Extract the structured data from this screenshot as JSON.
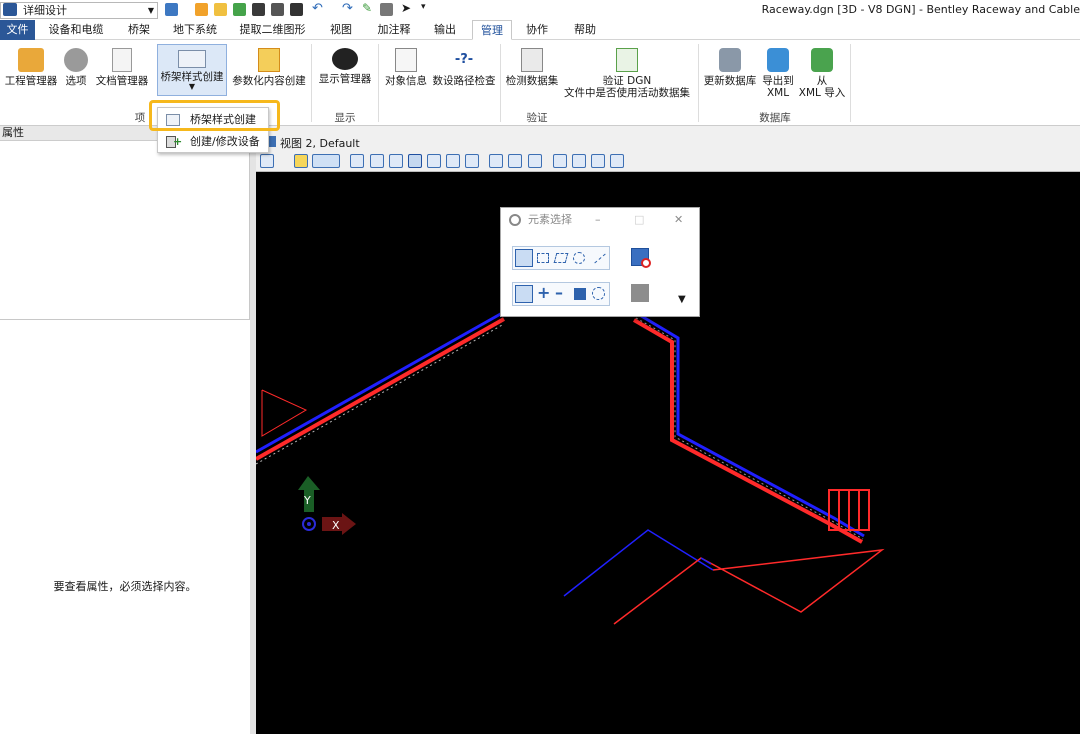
{
  "quick_access": {
    "workspace_value": "详细设计"
  },
  "window": {
    "title": "Raceway.dgn [3D - V8 DGN] - Bentley Raceway and Cable"
  },
  "tabs": [
    "文件",
    "设备和电缆",
    "桥架",
    "地下系统",
    "提取二维图形",
    "视图",
    "加注释",
    "输出",
    "管理",
    "协作",
    "帮助"
  ],
  "active_tab": "管理",
  "ribbon": {
    "project_group": {
      "label": "项目",
      "buttons": [
        "工程管理器",
        "选项",
        "文档管理器",
        "桥架样式创建",
        "参数化内容创建"
      ]
    },
    "display_group": {
      "label": "显示",
      "buttons": [
        "显示管理器"
      ]
    },
    "verify_group": {
      "label": "验证",
      "buttons": [
        "对象信息",
        "数设路径检查",
        "检测数据集"
      ],
      "verify_dgn_line1": "验证 DGN",
      "verify_dgn_line2": "文件中是否使用活动数据集"
    },
    "database_group": {
      "label": "数据库",
      "update_db": "更新数据库",
      "export_line1": "导出到",
      "export_line2": "XML",
      "import_line1": "从",
      "import_line2": "XML 导入"
    }
  },
  "dropdown_menu": {
    "items": [
      "桥架样式创建",
      "创建/修改设备"
    ]
  },
  "properties_panel": {
    "title": "属性",
    "empty_message": "要查看属性，必须选择内容。"
  },
  "view": {
    "tab_title": "视图 2, Default"
  },
  "element_selection_dialog": {
    "title": "元素选择"
  },
  "axis": {
    "x_label": "X",
    "y_label": "Y"
  },
  "colors": {
    "file_tab": "#2b5797",
    "highlight_border": "#f6b81c",
    "viewport_bg": "#000000",
    "cable_tray_red": "#ff2a2a",
    "cable_tray_blue": "#2020ff"
  }
}
